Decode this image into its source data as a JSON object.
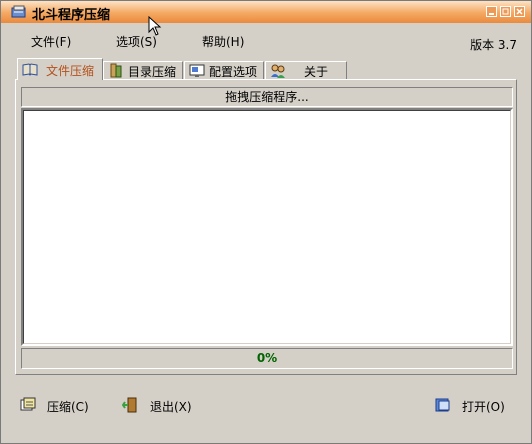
{
  "window": {
    "title": "北斗程序压缩"
  },
  "menu": {
    "file": "文件(F)",
    "options": "选项(S)",
    "help": "帮助(H)"
  },
  "version": "版本 3.7",
  "tabs": [
    {
      "label": "文件压缩",
      "icon": "book-icon"
    },
    {
      "label": "目录压缩",
      "icon": "folders-icon"
    },
    {
      "label": "配置选项",
      "icon": "config-icon"
    },
    {
      "label": "关于",
      "icon": "users-icon"
    }
  ],
  "panel": {
    "drop_hint": "拖拽压缩程序..."
  },
  "progress": {
    "value": 0,
    "label": "0%"
  },
  "actions": {
    "compress": "压缩(C)",
    "exit": "退出(X)",
    "open": "打开(O)"
  },
  "colors": {
    "titlebar": "#f4a862",
    "active_tab_text": "#b3501a",
    "progress_text": "#006400"
  }
}
